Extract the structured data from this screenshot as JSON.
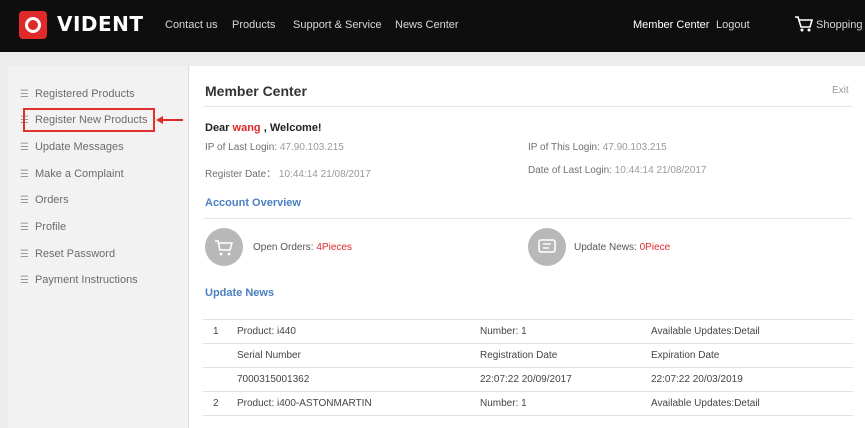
{
  "brand": {
    "name": "VIDENT",
    "logo_icon": "vident-logo-icon"
  },
  "nav": {
    "links": [
      "Contact us",
      "Products",
      "Support & Service",
      "News Center"
    ],
    "member_center": "Member Center",
    "logout": "Logout",
    "cart": "Shopping Cart"
  },
  "sidebar": {
    "items": [
      "Registered Products",
      "Register New Products",
      "Update Messages",
      "Make a Complaint",
      "Orders",
      "Profile",
      "Reset Password",
      "Payment Instructions"
    ],
    "selected": "Register New Products"
  },
  "main": {
    "title": "Member Center",
    "exit": "Exit",
    "greeting": {
      "dear": "Dear",
      "user": "wang",
      "comma": ",",
      "welcome": "Welcome!"
    },
    "ip_last_label": "IP of Last Login:",
    "ip_last": "47.90.103.215",
    "ip_this_label": "IP of This Login:",
    "ip_this": "47.90.103.215",
    "register_date_label": "Register Date：",
    "register_date": "10:44:14 21/08/2017",
    "last_login_label": "Date of Last Login:",
    "last_login": "10:44:14 21/08/2017",
    "account_overview": "Account Overview",
    "open_orders_label": "Open Orders:",
    "open_orders_value": "4Pieces",
    "update_news_label": "Update News:",
    "update_news_value": "0Piece",
    "update_news_heading": "Update News"
  },
  "table": {
    "rows": [
      [
        "1",
        "Product: i440",
        "Number: 1",
        "Available Updates:Detail"
      ],
      [
        "",
        "Serial Number",
        "Registration Date",
        "Expiration Date"
      ],
      [
        "",
        "7000315001362",
        "22:07:22 20/09/2017",
        "22:07:22 20/03/2019"
      ],
      [
        "2",
        "Product: i400-ASTONMARTIN",
        "Number: 1",
        "Available Updates:Detail"
      ]
    ]
  },
  "colors": {
    "accent_red": "#e02a2a",
    "link_blue": "#4a7fc0",
    "topbar": "#0e0e0e"
  }
}
